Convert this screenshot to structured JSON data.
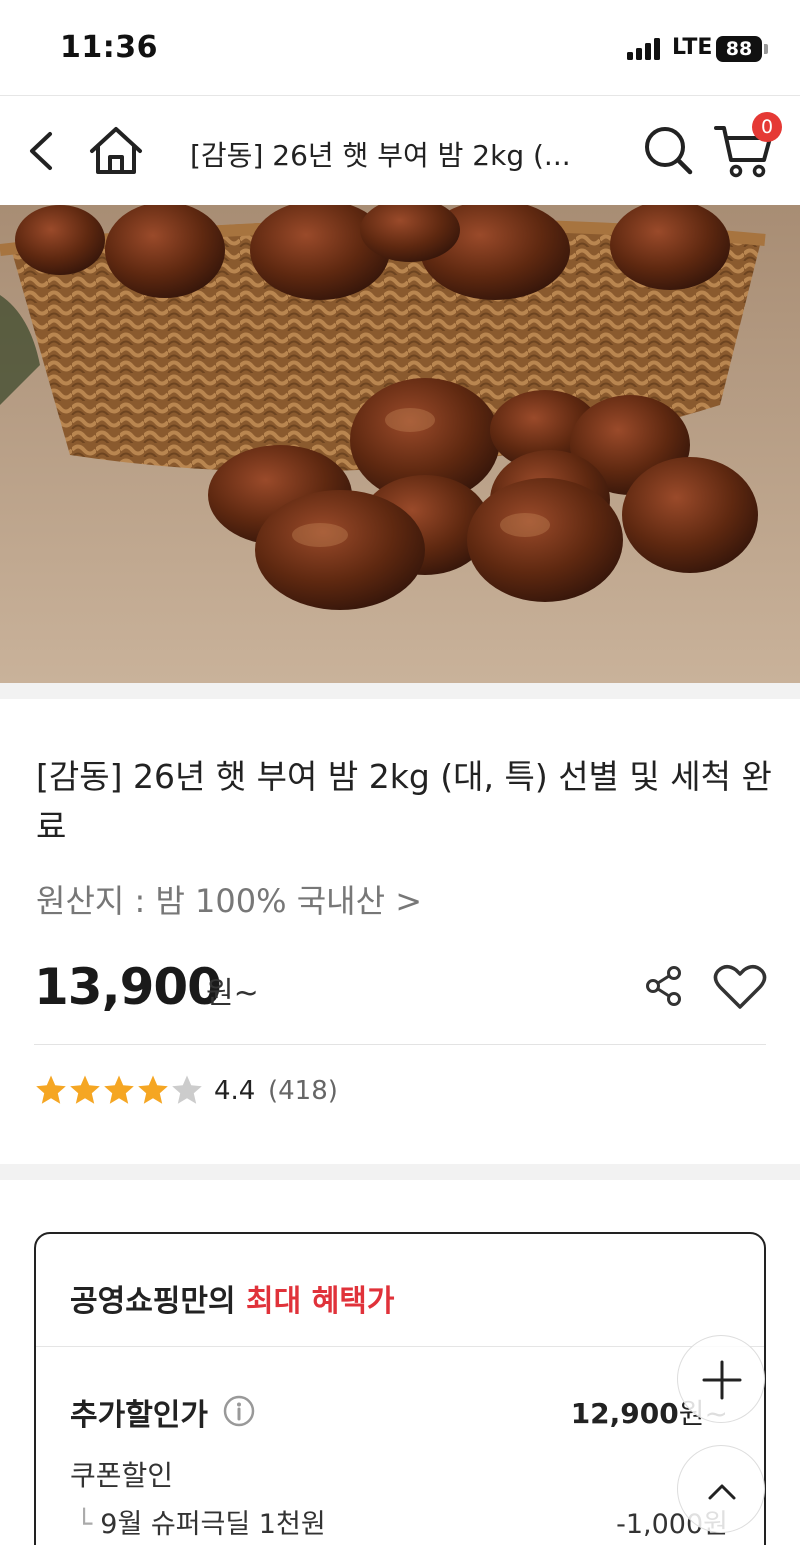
{
  "status_bar": {
    "time": "11:36",
    "network": "LTE",
    "battery": "88"
  },
  "header": {
    "title": "[감동] 26년 햇 부여 밤 2kg (...",
    "cart_count": "0",
    "icons": [
      "back-icon",
      "home-icon",
      "search-icon",
      "cart-icon"
    ]
  },
  "product": {
    "title": "[감동] 26년 햇 부여 밤 2kg (대, 특) 선별 및 세척 완료",
    "origin": "원산지 : 밤 100% 국내산 >",
    "price": "13,900",
    "price_suffix": "원~",
    "rating": 4.4,
    "rating_text": "4.4",
    "review_count": "(418)",
    "icons": [
      "share-icon",
      "heart-icon",
      "star-icon"
    ]
  },
  "benefit": {
    "heading_prefix": "공영쇼핑만의 ",
    "heading_accent": "최대 혜택가",
    "accent_color": "#e0323a",
    "extra_label": "추가할인가",
    "extra_value": "12,900",
    "extra_unit": "원~",
    "coupon_label": "쿠폰할인",
    "coupon_branch": "└",
    "coupon_item": "9월 슈퍼극딜 1천원",
    "coupon_value": "-1,000원"
  },
  "colors": {
    "star": "#f5a623",
    "star_empty": "#cccccc",
    "badge": "#e53935"
  }
}
